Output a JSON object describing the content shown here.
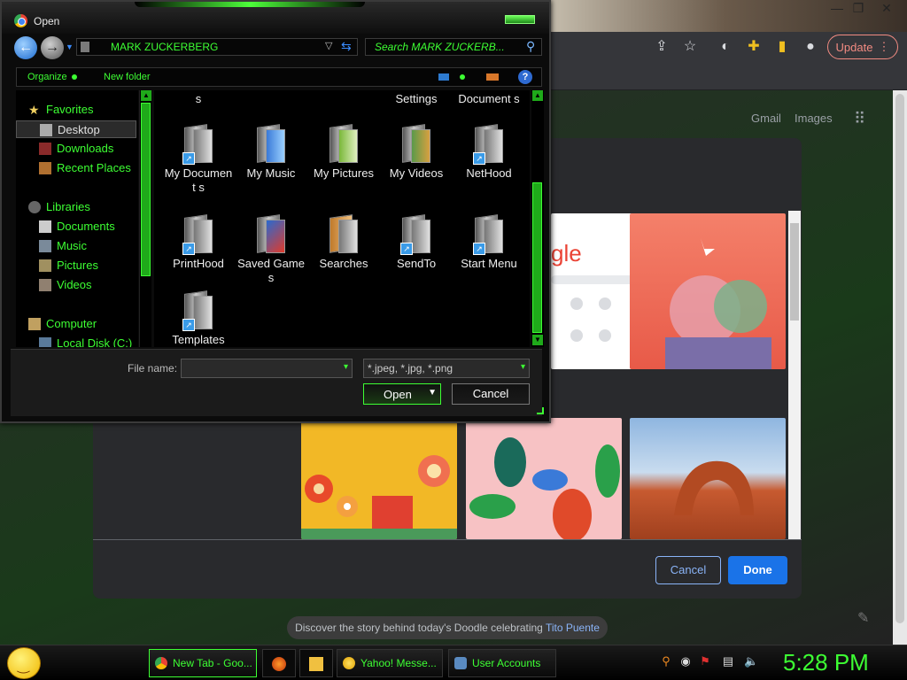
{
  "browser": {
    "update_label": "Update",
    "ntp_links": {
      "gmail": "Gmail",
      "images": "Images"
    },
    "customize": {
      "cancel_label": "Cancel",
      "done_label": "Done",
      "google_tile_text": "gle"
    },
    "doodle": {
      "text": "Discover the story behind today's Doodle celebrating ",
      "link": "Tito Puente"
    }
  },
  "dialog": {
    "title": "Open",
    "address": "MARK ZUCKERBERG",
    "search_placeholder": "Search MARK ZUCKERB...",
    "organize_label": "Organize",
    "new_folder_label": "New folder",
    "help_label": "?",
    "nav": {
      "favorites": "Favorites",
      "desktop": "Desktop",
      "downloads": "Downloads",
      "recent_places": "Recent Places",
      "libraries": "Libraries",
      "documents": "Documents",
      "music": "Music",
      "pictures": "Pictures",
      "videos": "Videos",
      "computer": "Computer",
      "local_disk": "Local Disk (C:)"
    },
    "files": [
      {
        "label": "s"
      },
      {
        "label": "Settings"
      },
      {
        "label": "Document s"
      },
      {
        "label": "My Document s"
      },
      {
        "label": "My Music"
      },
      {
        "label": "My Pictures"
      },
      {
        "label": "My Videos"
      },
      {
        "label": "NetHood"
      },
      {
        "label": "PrintHood"
      },
      {
        "label": "Saved Games"
      },
      {
        "label": "Searches"
      },
      {
        "label": "SendTo"
      },
      {
        "label": "Start Menu"
      },
      {
        "label": "Templates"
      }
    ],
    "file_name_label": "File name:",
    "file_name_value": "",
    "file_type": "*.jpeg, *.jpg, *.png",
    "open_label": "Open",
    "cancel_label": "Cancel"
  },
  "taskbar": {
    "tasks": [
      {
        "label": "New Tab - Goo..."
      },
      {
        "label": "Yahoo! Messe..."
      },
      {
        "label": "User Accounts"
      }
    ],
    "clock": "5:28 PM"
  },
  "colors": {
    "accent_green": "#3dff33",
    "chrome_blue": "#1a73e8",
    "update_red": "#f28b82"
  }
}
